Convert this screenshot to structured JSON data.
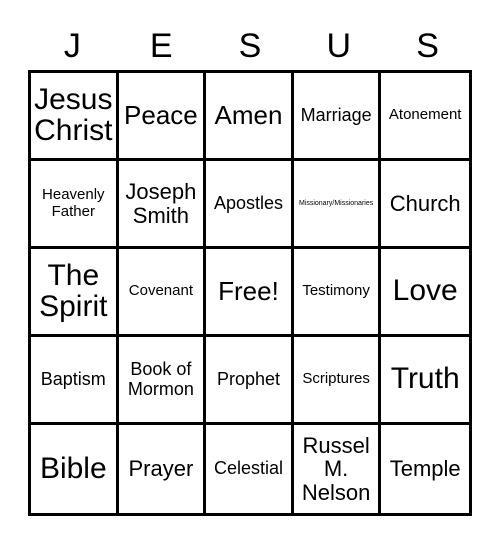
{
  "card": {
    "header_letters": [
      "J",
      "E",
      "S",
      "U",
      "S"
    ],
    "colors": {
      "background": "#ffffff",
      "border": "#000000",
      "text": "#000000"
    },
    "rows": [
      [
        {
          "label": "Jesus Christ",
          "size": "xxl"
        },
        {
          "label": "Peace",
          "size": "xl"
        },
        {
          "label": "Amen",
          "size": "xl"
        },
        {
          "label": "Marriage",
          "size": "md"
        },
        {
          "label": "Atonement",
          "size": "sm"
        }
      ],
      [
        {
          "label": "Heavenly Father",
          "size": "sm"
        },
        {
          "label": "Joseph Smith",
          "size": "lg"
        },
        {
          "label": "Apostles",
          "size": "md"
        },
        {
          "label": "Missionary/Missionaries",
          "size": "xxs"
        },
        {
          "label": "Church",
          "size": "lg"
        }
      ],
      [
        {
          "label": "The Spirit",
          "size": "xxl"
        },
        {
          "label": "Covenant",
          "size": "sm"
        },
        {
          "label": "Free!",
          "size": "xl"
        },
        {
          "label": "Testimony",
          "size": "sm"
        },
        {
          "label": "Love",
          "size": "xxl"
        }
      ],
      [
        {
          "label": "Baptism",
          "size": "md"
        },
        {
          "label": "Book of Mormon",
          "size": "md"
        },
        {
          "label": "Prophet",
          "size": "md"
        },
        {
          "label": "Scriptures",
          "size": "sm"
        },
        {
          "label": "Truth",
          "size": "xxl"
        }
      ],
      [
        {
          "label": "Bible",
          "size": "xxl"
        },
        {
          "label": "Prayer",
          "size": "lg"
        },
        {
          "label": "Celestial",
          "size": "md"
        },
        {
          "label": "Russel M. Nelson",
          "size": "lg"
        },
        {
          "label": "Temple",
          "size": "lg"
        }
      ]
    ]
  }
}
